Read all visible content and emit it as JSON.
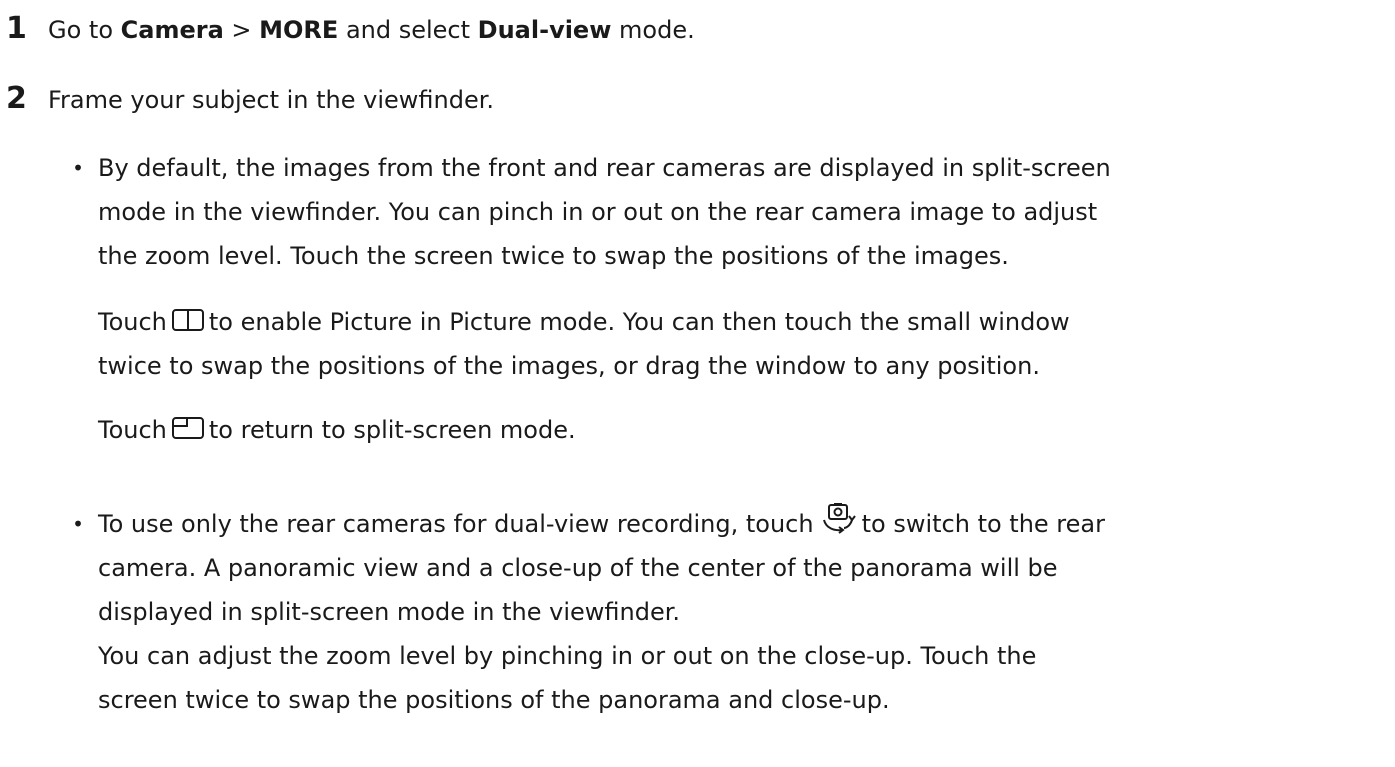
{
  "steps": [
    {
      "number": "1",
      "segments": [
        {
          "text": "Go to ",
          "bold": false
        },
        {
          "text": "Camera",
          "bold": true
        },
        {
          "text": " > ",
          "bold": false
        },
        {
          "text": "MORE",
          "bold": true
        },
        {
          "text": " and select ",
          "bold": false
        },
        {
          "text": "Dual-view",
          "bold": true
        },
        {
          "text": " mode.",
          "bold": false
        }
      ]
    },
    {
      "number": "2",
      "text": "Frame your subject in the viewfinder."
    }
  ],
  "bullet1": {
    "dot": "•",
    "lines": [
      "By default, the images from the front and rear cameras are displayed in split-screen",
      "mode in the viewfinder. You can pinch in or out on the rear camera image to adjust",
      "the zoom level. Touch the screen twice to swap the positions of the images."
    ]
  },
  "sub1": {
    "prefix": "Touch",
    "icon": "split-screen-icon",
    "line1_rest": "to enable Picture in Picture mode. You can then touch the small window",
    "line2": "twice to swap the positions of the images, or drag the window to any position."
  },
  "sub2": {
    "prefix": "Touch",
    "icon": "picture-in-picture-icon",
    "rest": "to return to split-screen mode."
  },
  "bullet2": {
    "dot": "•",
    "line1_prefix": "To use only the rear cameras for dual-view recording, touch",
    "icon": "switch-camera-icon",
    "line1_rest": "to switch to the rear",
    "lines": [
      "camera. A panoramic view and a close-up of the center of the panorama will be",
      "displayed in split-screen mode in the viewfinder.",
      "You can adjust the zoom level by pinching in or out on the close-up. Touch the",
      "screen twice to swap the positions of the panorama and close-up."
    ]
  }
}
